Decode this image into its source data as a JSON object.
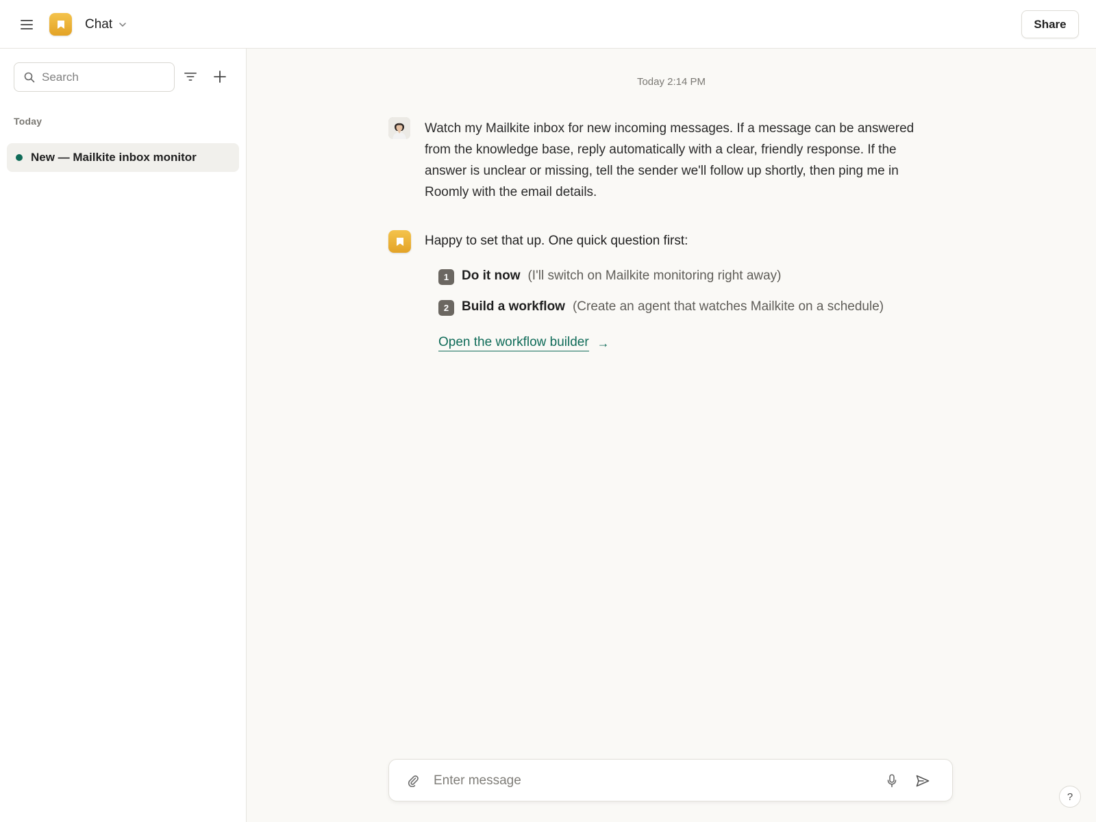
{
  "header": {
    "app_title": "Chat",
    "share_label": "Share"
  },
  "sidebar": {
    "search_placeholder": "Search",
    "section_label": "Today",
    "conversations": [
      {
        "title": "New — Mailkite inbox monitor",
        "status_color": "#0f6b58"
      }
    ]
  },
  "chat": {
    "timestamp": "Today 2:14 PM",
    "user_message": "Watch my Mailkite inbox for new incoming messages. If a message can be answered from the knowledge base, reply automatically with a clear, friendly response. If the answer is unclear or missing, tell the sender we'll follow up shortly, then ping me in Roomly with the email details.",
    "bot_intro": "Happy to set that up. One quick question first:",
    "options": [
      {
        "number": "1",
        "label": "Do it now",
        "description": "(I'll switch on Mailkite monitoring right away)"
      },
      {
        "number": "2",
        "label": "Build a workflow",
        "description": "(Create an agent that watches Mailkite on a schedule)"
      }
    ],
    "link_label": "Open the workflow builder",
    "link_arrow": "→"
  },
  "composer": {
    "placeholder": "Enter message"
  },
  "help_label": "?",
  "colors": {
    "accent": "#0f6b58",
    "brand": "#f0b53a"
  }
}
